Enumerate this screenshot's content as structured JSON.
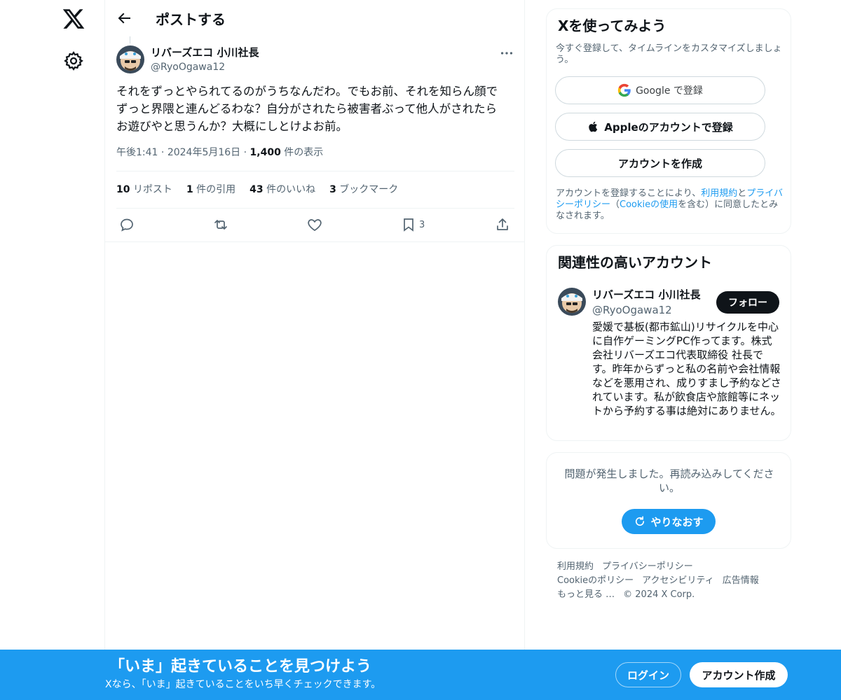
{
  "nav": {
    "logo_icon": "x-logo-icon",
    "settings_icon": "gear-icon"
  },
  "header": {
    "title": "ポストする",
    "back_icon": "arrow-left-icon"
  },
  "post": {
    "author_name": "リバーズエコ 小川社長",
    "author_handle": "@RyoOgawa12",
    "text": "それをずっとやられてるのがうちなんだわ。でもお前、それを知らん顔で\nずっと界隈と連んどるわな？自分がされたら被害者ぶって他人がされたら\nお遊びやと思うんか？大概にしとけよお前。",
    "time": "午後1:41",
    "date": "2024年5月16日",
    "views_count": "1,400",
    "views_label": "件の表示",
    "stats": [
      {
        "count": "10",
        "label": "リポスト"
      },
      {
        "count": "1",
        "label": "件の引用"
      },
      {
        "count": "43",
        "label": "件のいいね"
      },
      {
        "count": "3",
        "label": "ブックマーク"
      }
    ],
    "bookmark_count": "3"
  },
  "signup": {
    "title": "Xを使ってみよう",
    "subtitle": "今すぐ登録して、タイムラインをカスタマイズしましょう。",
    "google_label": "Google で登録",
    "apple_label": "Appleのアカウントで登録",
    "create_label": "アカウントを作成",
    "terms_prefix": "アカウントを登録することにより、",
    "terms_link": "利用規約",
    "terms_and": "と",
    "privacy_link": "プライバシーポリシー",
    "terms_paren_open": "（",
    "cookie_link": "Cookieの使用",
    "terms_suffix": "を含む）に同意したとみなされます。"
  },
  "related": {
    "title": "関連性の高いアカウント",
    "name": "リバーズエコ 小川社長",
    "handle": "@RyoOgawa12",
    "follow_label": "フォロー",
    "bio": "愛媛で基板(都市鉱山)リサイクルを中心に自作ゲーミングPC作ってます。株式会社リバーズエコ代表取締役 社長です。昨年からずっと私の名前や会社情報などを悪用され、成りすまし予約などされています。私が飲食店や旅館等にネットから予約する事は絶対にありません。"
  },
  "error_card": {
    "message": "問題が発生しました。再読み込みしてください。",
    "retry_label": "やりなおす"
  },
  "footer": {
    "terms": "利用規約",
    "privacy": "プライバシーポリシー",
    "cookie": "Cookieのポリシー",
    "accessibility": "アクセシビリティ",
    "ads": "広告情報",
    "more": "もっと見る …",
    "copyright": "© 2024 X Corp."
  },
  "bottom_bar": {
    "title": "「いま」起きていることを見つけよう",
    "subtitle": "Xなら、「いま」起きていることをいち早くチェックできます。",
    "login_label": "ログイン",
    "signup_label": "アカウント作成"
  },
  "colors": {
    "accent": "#1d9bf0",
    "text": "#0f1419",
    "muted": "#536471",
    "border": "#eff3f4"
  }
}
